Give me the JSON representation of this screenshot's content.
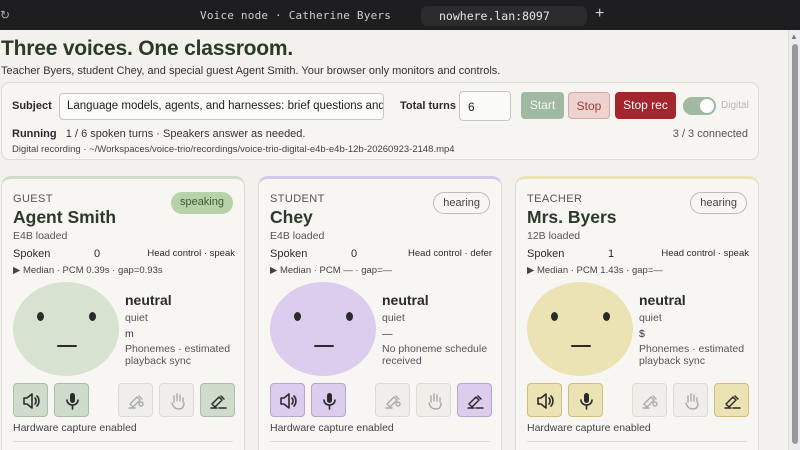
{
  "browser": {
    "window_title": "Voice node · Catherine Byers",
    "url": "nowhere.lan:8097",
    "new_tab_glyph": "+"
  },
  "page": {
    "title": "Three voices. One classroom.",
    "subtitle": "Teacher Byers, student Chey, and special guest Agent Smith. Your browser only monitors and controls."
  },
  "controls": {
    "subject_label": "Subject",
    "subject_value": "Language models, agents, and harnesses: brief questions and answers",
    "total_turns_label": "Total turns",
    "total_turns_value": "6",
    "start_label": "Start",
    "stop_label": "Stop",
    "stop_rec_label": "Stop rec",
    "digital_label": "Digital",
    "digital_on": true,
    "status_state": "Running",
    "status_text": "1 / 6 spoken turns · Speakers answer as needed.",
    "connected": "3 / 3 connected",
    "recording": "Digital recording · ~/Workspaces/voice-trio/recordings/voice-trio-digital-e4b-e4b-12b-20260923-2148.mp4"
  },
  "cards": [
    {
      "role": "GUEST",
      "name": "Agent Smith",
      "model": "E4B loaded",
      "badge": "speaking",
      "spoken_label": "Spoken",
      "spoken": "0",
      "head_control": "Head control · speak",
      "median": "▶ Median · PCM 0.39s · gap=0.93s",
      "emotion": "neutral",
      "level": "quiet",
      "phoneme": "m",
      "note": "Phonemes · estimated playback sync",
      "hardware": "Hardware capture enabled",
      "color": "#cfdccb"
    },
    {
      "role": "STUDENT",
      "name": "Chey",
      "model": "E4B loaded",
      "badge": "hearing",
      "spoken_label": "Spoken",
      "spoken": "0",
      "head_control": "Head control · defer",
      "median": "▶ Median · PCM — · gap=—",
      "emotion": "neutral",
      "level": "quiet",
      "phoneme": "—",
      "note": "No phoneme schedule received",
      "hardware": "Hardware capture enabled",
      "color": "#dccced"
    },
    {
      "role": "TEACHER",
      "name": "Mrs. Byers",
      "model": "12B loaded",
      "badge": "hearing",
      "spoken_label": "Spoken",
      "spoken": "1",
      "head_control": "Head control · speak",
      "median": "▶ Median · PCM 1.43s · gap=—",
      "emotion": "neutral",
      "level": "quiet",
      "phoneme": "$",
      "note": "Phonemes · estimated playback sync",
      "hardware": "Hardware capture enabled",
      "color": "#ece3b4"
    }
  ],
  "icons": [
    "speaker-icon",
    "microphone-icon",
    "camera-icon",
    "gesture-hand-icon",
    "head-tilt-icon"
  ]
}
